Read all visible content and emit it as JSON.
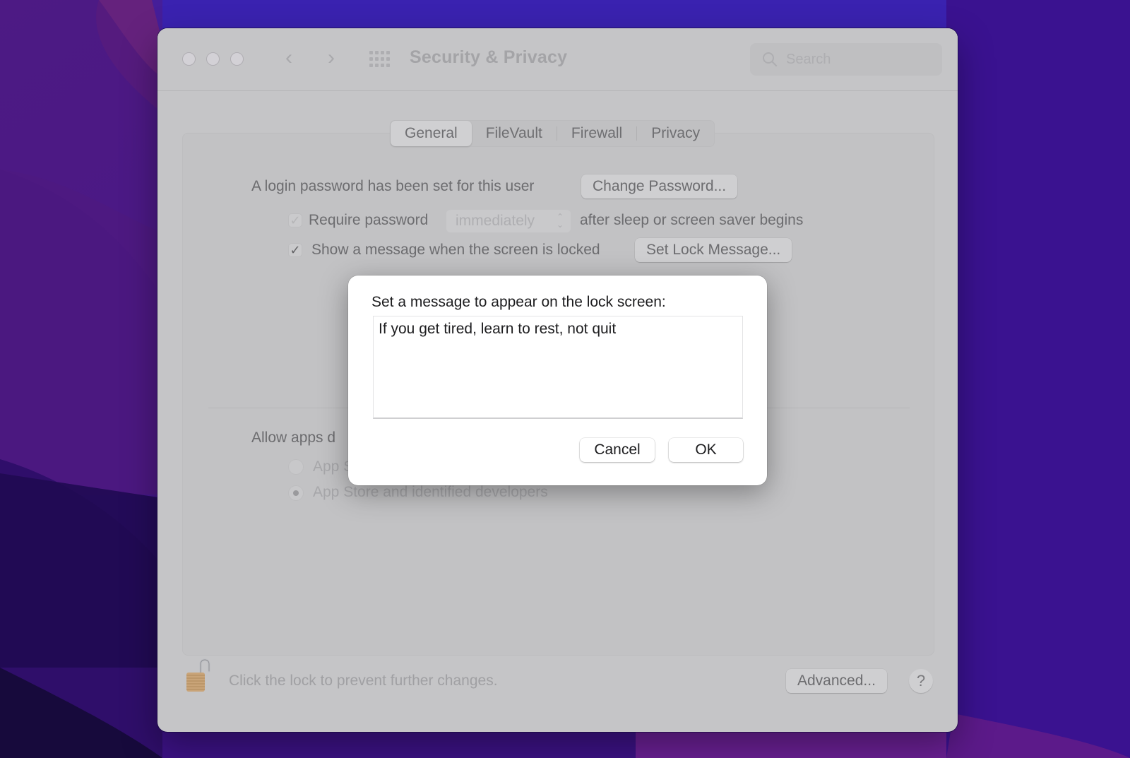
{
  "window": {
    "title": "Security & Privacy",
    "search_placeholder": "Search",
    "nav_back_glyph": "‹",
    "nav_forward_glyph": "›"
  },
  "tabs": [
    {
      "label": "General",
      "active": true
    },
    {
      "label": "FileVault",
      "active": false
    },
    {
      "label": "Firewall",
      "active": false
    },
    {
      "label": "Privacy",
      "active": false
    }
  ],
  "general": {
    "login_password_text": "A login password has been set for this user",
    "change_password_button": "Change Password...",
    "require_password": {
      "label": "Require password",
      "checked": true,
      "enabled": false,
      "popup_value": "immediately",
      "suffix": "after sleep or screen saver begins"
    },
    "show_message": {
      "label": "Show a message when the screen is locked",
      "checked": true,
      "button": "Set Lock Message..."
    },
    "allow_apps": {
      "label_visible": "Allow apps d",
      "options": [
        {
          "label": "App S",
          "selected": false
        },
        {
          "label": "App Store and identified developers",
          "selected": true
        }
      ]
    }
  },
  "footer": {
    "lock_text": "Click the lock to prevent further changes.",
    "advanced_button": "Advanced...",
    "help_button": "?"
  },
  "dialog": {
    "prompt": "Set a message to appear on the lock screen:",
    "message_value": "If you get tired, learn to rest, not quit",
    "cancel_button": "Cancel",
    "ok_button": "OK"
  },
  "icons": {
    "checkmark": "✓",
    "popup_arrows_up": "⌃",
    "popup_arrows_down": "⌄"
  }
}
